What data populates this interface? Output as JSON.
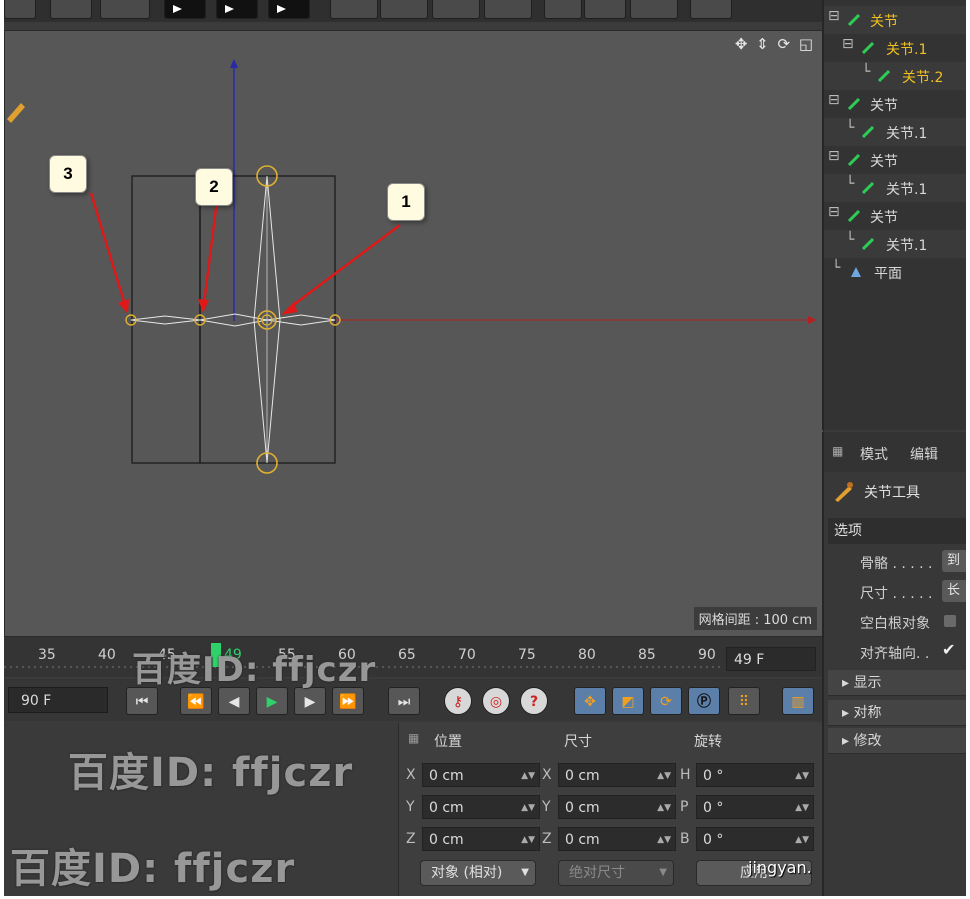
{
  "viewport": {
    "grid_label": "网格间距 : 100 cm",
    "nav_icons": "✥ ⇕ ⟳ ◱"
  },
  "callouts": [
    {
      "label": "1"
    },
    {
      "label": "2"
    },
    {
      "label": "3"
    }
  ],
  "object_manager": {
    "items": [
      {
        "label": "关节",
        "tree": "",
        "highlight": true
      },
      {
        "label": "关节.1",
        "tree": "",
        "highlight": true
      },
      {
        "label": "关节.2",
        "tree": "└",
        "highlight": true
      },
      {
        "label": "关节",
        "tree": ""
      },
      {
        "label": "关节.1",
        "tree": "└"
      },
      {
        "label": "关节",
        "tree": ""
      },
      {
        "label": "关节.1",
        "tree": "└"
      },
      {
        "label": "关节",
        "tree": ""
      },
      {
        "label": "关节.1",
        "tree": "└"
      },
      {
        "label": "平面",
        "tree": "└"
      }
    ]
  },
  "attributes": {
    "tabs": [
      "模式",
      "编辑"
    ],
    "tool_name": "关节工具",
    "section": "选项",
    "rows": [
      {
        "label": "骨骼 . . . . .",
        "button": "到"
      },
      {
        "label": "尺寸 . . . . .",
        "button": "长"
      },
      {
        "label": "空白根对象"
      },
      {
        "label": "对齐轴向. ."
      }
    ],
    "folds": [
      "显示",
      "对称",
      "修改"
    ]
  },
  "timeline": {
    "ticks": [
      "35",
      "40",
      "45",
      "49",
      "55",
      "60",
      "65",
      "70",
      "75",
      "80",
      "85",
      "90"
    ],
    "current_frame": "49 F"
  },
  "transport": {
    "end_frame": "90 F"
  },
  "coordinates": {
    "headers": [
      "位置",
      "尺寸",
      "旋转"
    ],
    "rows": [
      {
        "pos_axis": "X",
        "pos": "0 cm",
        "size_axis": "X",
        "size": "0 cm",
        "rot_axis": "H",
        "rot": "0 °"
      },
      {
        "pos_axis": "Y",
        "pos": "0 cm",
        "size_axis": "Y",
        "size": "0 cm",
        "rot_axis": "P",
        "rot": "0 °"
      },
      {
        "pos_axis": "Z",
        "pos": "0 cm",
        "size_axis": "Z",
        "size": "0 cm",
        "rot_axis": "B",
        "rot": "0 °"
      }
    ],
    "mode_dropdown": "对象 (相对)",
    "size_dropdown": "绝对尺寸",
    "apply_button": "应用"
  },
  "watermarks": [
    "百度ID: ffjczr",
    "百度ID: ffjczr",
    "百度ID: ffjczr"
  ],
  "site_mark": "jingyan."
}
